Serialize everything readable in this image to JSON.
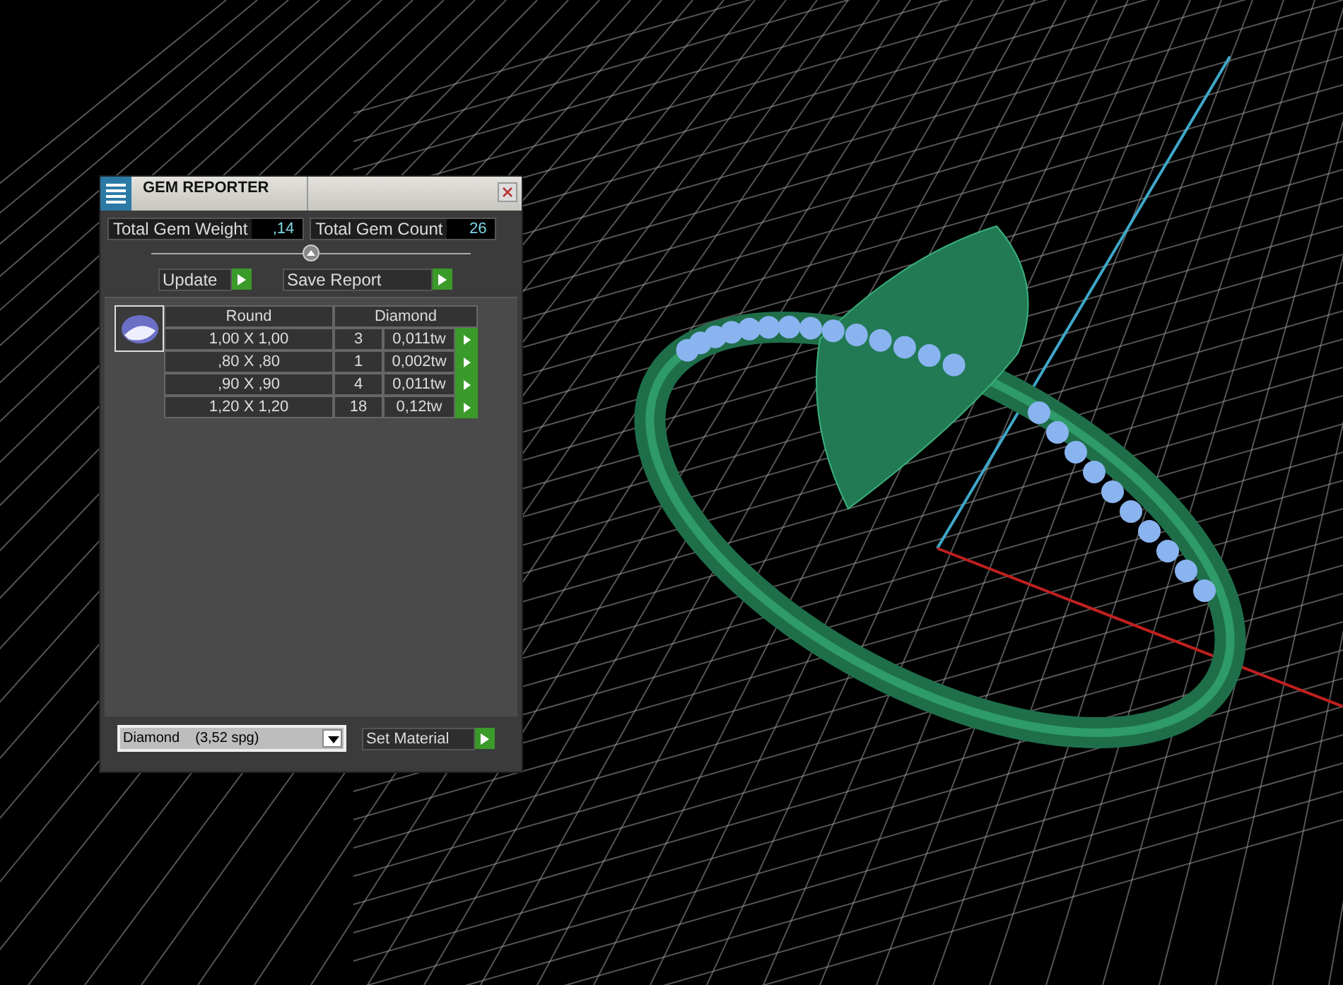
{
  "window": {
    "title": "GEM REPORTER"
  },
  "totals": [
    {
      "label": "Total Gem Weight",
      "value": ",14"
    },
    {
      "label": "Total Gem Count",
      "value": "26"
    }
  ],
  "actions": [
    "Update",
    "Save Report"
  ],
  "table": {
    "columns": [
      "Round",
      "Diamond"
    ],
    "rows": [
      {
        "size": "1,00 X 1,00",
        "count": "3",
        "weight": "0,011tw"
      },
      {
        "size": ",80 X ,80",
        "count": "1",
        "weight": "0,002tw"
      },
      {
        "size": ",90 X ,90",
        "count": "4",
        "weight": "0,011tw"
      },
      {
        "size": "1,20 X 1,20",
        "count": "18",
        "weight": "0,12tw"
      }
    ]
  },
  "material": {
    "value": "Diamond    (3,52 spg)",
    "button": "Set Material"
  }
}
